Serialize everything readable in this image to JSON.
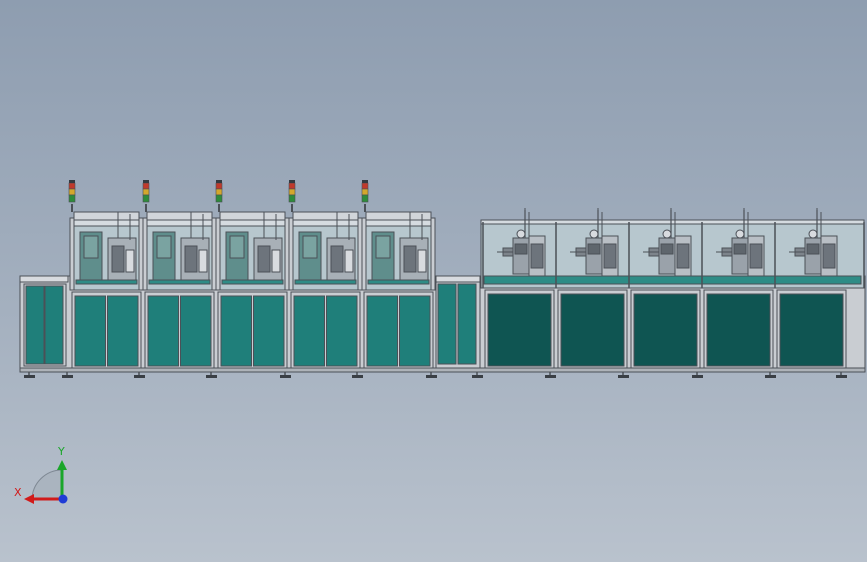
{
  "colors": {
    "background_top": "#8e9db0",
    "background_bottom": "#b9c2cd",
    "frame": "#c9cdd2",
    "frame_dark": "#4b5057",
    "panel": "#1f7f7a",
    "panel_dark": "#0f5552",
    "glass": "#b7c7ce",
    "belt": "#2e8c86",
    "beacon_red": "#c0392b",
    "beacon_yellow": "#d4a72c",
    "beacon_green": "#2e8b3a",
    "axis_x": "#d11a1a",
    "axis_y": "#1aa62a",
    "axis_z": "#1f3cd6"
  },
  "scene": {
    "left_stations": 5,
    "right_stations": 5,
    "beacons": 5
  },
  "triad": {
    "x_label": "X",
    "y_label": "Y"
  }
}
